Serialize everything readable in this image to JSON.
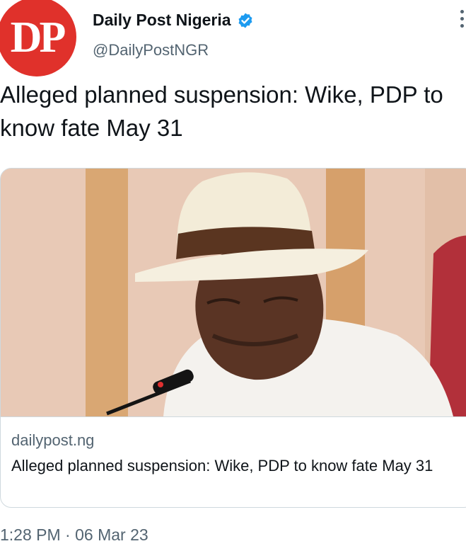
{
  "account": {
    "avatar_text": "DP",
    "display_name": "Daily Post Nigeria",
    "handle": "@DailyPostNGR",
    "verified": true,
    "brand_color": "#e0312b",
    "verified_color": "#1d9bf0"
  },
  "tweet": {
    "text": "Alleged planned suspension: Wike, PDP to know fate May 31",
    "timestamp": "1:28 PM · 06 Mar 23"
  },
  "card": {
    "image_icon": "photo-icon",
    "domain": "dailypost.ng",
    "title": "Alleged planned suspension: Wike, PDP to know fate May 31"
  },
  "icons": {
    "more": "more-vertical-icon",
    "verified": "verified-badge-icon"
  }
}
